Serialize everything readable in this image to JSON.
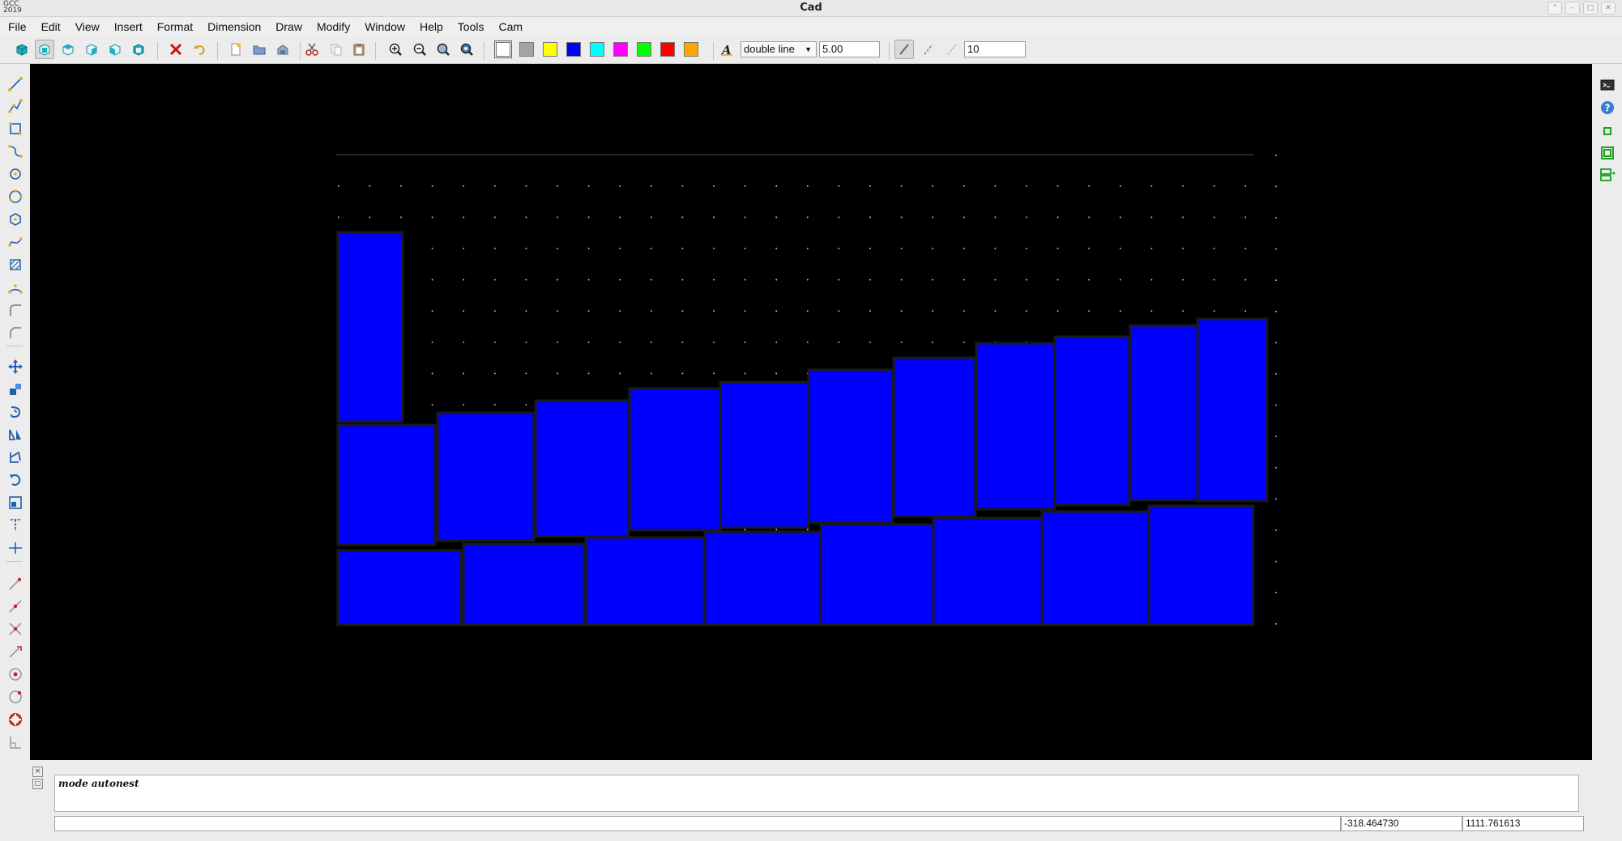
{
  "window": {
    "title": "Cad",
    "logo_text": "GCC 2019"
  },
  "menu": [
    "File",
    "Edit",
    "View",
    "Insert",
    "Format",
    "Dimension",
    "Draw",
    "Modify",
    "Window",
    "Help",
    "Tools",
    "Cam"
  ],
  "toolbar": {
    "view_icons": [
      "3d-view-icon",
      "front-view-icon",
      "top-view-icon",
      "right-view-icon",
      "left-view-icon",
      "back-view-icon"
    ],
    "edit_icons": [
      "delete-icon",
      "undo-icon"
    ],
    "file_icons": [
      "new-file-icon",
      "open-file-icon",
      "save-file-icon"
    ],
    "clipboard_icons": [
      "cut-icon",
      "copy-icon",
      "paste-icon"
    ],
    "zoom_icons": [
      "zoom-in-icon",
      "zoom-out-icon",
      "zoom-window-icon",
      "zoom-all-icon"
    ],
    "colors": [
      "#ffffff",
      "#a0a4a8",
      "#ffff00",
      "#0000ff",
      "#00ffff",
      "#ff00ff",
      "#00ff00",
      "#ff0000",
      "#ffa500"
    ],
    "line_type": "double line",
    "line_width": "5.00",
    "snap_value": "10",
    "pen_icons": [
      "pen-icon",
      "pen-dashed-icon",
      "pen-dotted-icon"
    ]
  },
  "left_tools": [
    "line-icon",
    "polyline-icon",
    "rectangle-icon",
    "bezier-icon",
    "circle-icon",
    "polygon-icon",
    "hexagon-icon",
    "spline-icon",
    "hatch-icon",
    "arc-icon",
    "fillet-icon",
    "chamfer-icon",
    "move-icon",
    "copy-objects-icon",
    "offset-icon",
    "mirror-icon",
    "rotate-icon",
    "scale-icon",
    "vertical-measure-icon",
    "cross-measure-icon",
    "snap-endpoint-icon",
    "snap-midpoint-icon",
    "snap-intersection-icon",
    "snap-nearest-icon",
    "snap-center-icon",
    "snap-circle-icon",
    "snap-quadrant-icon",
    "snap-perpendicular-icon"
  ],
  "right_tools": [
    "terminal-icon",
    "help-icon",
    "small-square-icon",
    "framed-square-icon",
    "layers-icon"
  ],
  "console": {
    "message": "mode autonest",
    "command": "",
    "x": "-318.464730",
    "y": "1111.761613"
  }
}
